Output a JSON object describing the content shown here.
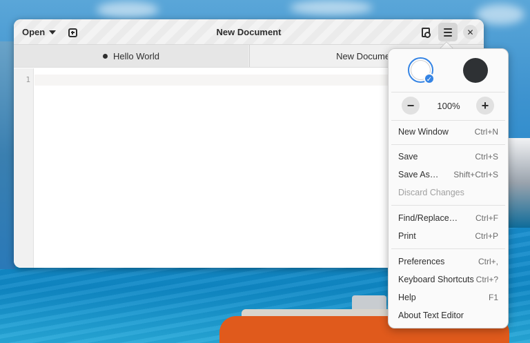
{
  "window": {
    "title": "New Document",
    "open_label": "Open"
  },
  "tabs": [
    {
      "label": "Hello World",
      "modified": true,
      "active": true
    },
    {
      "label": "New Document",
      "modified": false,
      "active": false
    }
  ],
  "editor": {
    "line_numbers": [
      "1"
    ],
    "content": ""
  },
  "menu": {
    "style_options": [
      "light",
      "dark"
    ],
    "selected_style": "light",
    "zoom_level": "100%",
    "zoom_out_label": "−",
    "zoom_in_label": "+",
    "items": [
      {
        "label": "New Window",
        "accel": "Ctrl+N",
        "enabled": true
      },
      {
        "label": "Save",
        "accel": "Ctrl+S",
        "enabled": true
      },
      {
        "label": "Save As…",
        "accel": "Shift+Ctrl+S",
        "enabled": true
      },
      {
        "label": "Discard Changes",
        "accel": "",
        "enabled": false
      },
      {
        "label": "Find/Replace…",
        "accel": "Ctrl+F",
        "enabled": true
      },
      {
        "label": "Print",
        "accel": "Ctrl+P",
        "enabled": true
      },
      {
        "label": "Preferences",
        "accel": "Ctrl+,",
        "enabled": true
      },
      {
        "label": "Keyboard Shortcuts",
        "accel": "Ctrl+?",
        "enabled": true
      },
      {
        "label": "Help",
        "accel": "F1",
        "enabled": true
      },
      {
        "label": "About Text Editor",
        "accel": "",
        "enabled": true
      }
    ]
  },
  "colors": {
    "accent": "#3584e4",
    "window_bg": "#ffffff",
    "headerbar_bg": "#ebebeb"
  }
}
